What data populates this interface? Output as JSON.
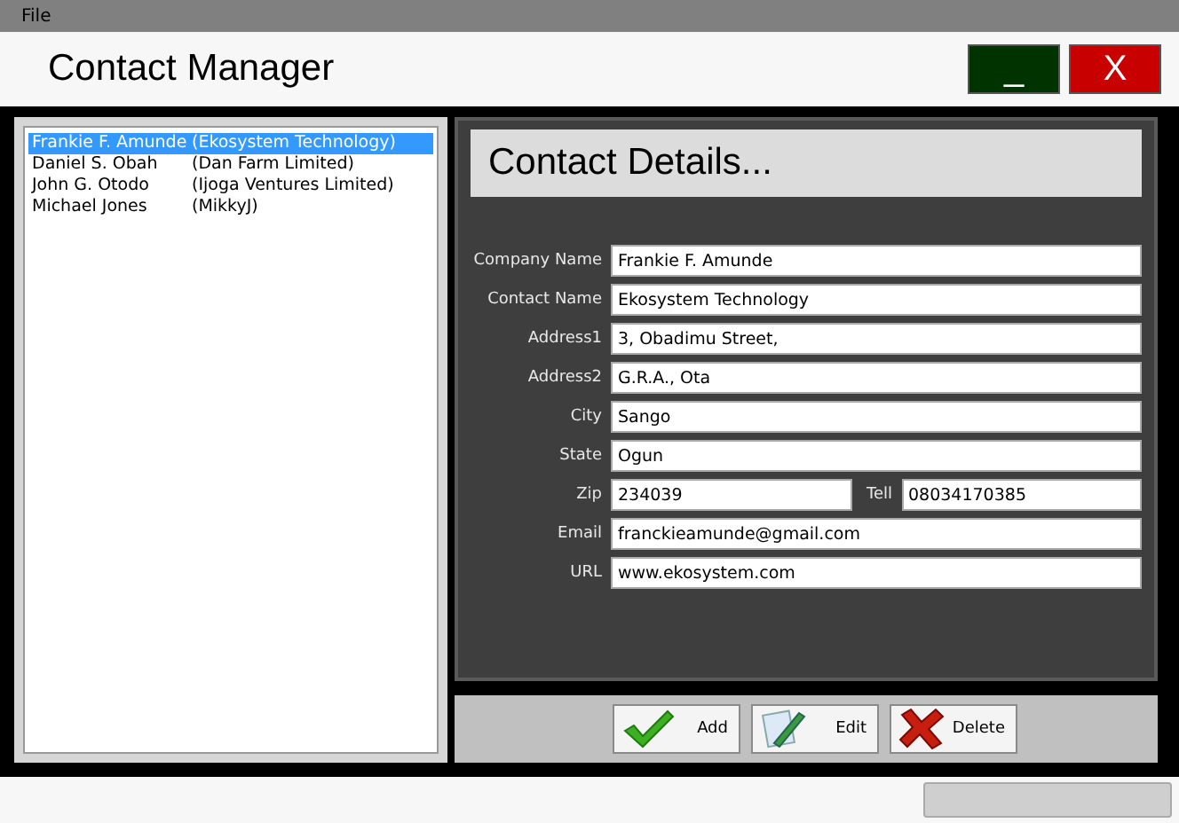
{
  "menu": [
    "File"
  ],
  "window": {
    "title": "Contact Manager",
    "buttons": [
      {
        "kind": "minimize",
        "label": "_"
      },
      {
        "kind": "close",
        "label": "X"
      }
    ]
  },
  "contacts": [
    {
      "name": "Frankie F. Amunde",
      "company": "(Ekosystem Technology)",
      "selected": true
    },
    {
      "name": "Daniel S. Obah",
      "company": "(Dan Farm Limited)",
      "selected": false
    },
    {
      "name": "John G. Otodo",
      "company": "(Ijoga Ventures Limited)",
      "selected": false
    },
    {
      "name": "Michael Jones",
      "company": "(MikkyJ)",
      "selected": false
    }
  ],
  "details": {
    "heading": "Contact Details...",
    "rows": [
      {
        "fields": [
          {
            "label": "Company Name",
            "value": "Frankie F. Amunde"
          }
        ]
      },
      {
        "fields": [
          {
            "label": "Contact Name",
            "value": "Ekosystem Technology"
          }
        ]
      },
      {
        "fields": [
          {
            "label": "Address1",
            "value": "3, Obadimu Street,"
          }
        ]
      },
      {
        "fields": [
          {
            "label": "Address2",
            "value": "G.R.A., Ota"
          }
        ]
      },
      {
        "fields": [
          {
            "label": "City",
            "value": "Sango"
          }
        ]
      },
      {
        "fields": [
          {
            "label": "State",
            "value": "Ogun"
          }
        ]
      },
      {
        "fields": [
          {
            "label": "Zip",
            "value": "234039"
          },
          {
            "label": "Tell",
            "value": "08034170385"
          }
        ]
      },
      {
        "fields": [
          {
            "label": "Email",
            "value": "franckieamunde@gmail.com"
          }
        ]
      },
      {
        "fields": [
          {
            "label": "URL",
            "value": "www.ekosystem.com"
          }
        ]
      }
    ]
  },
  "actions": [
    {
      "kind": "add",
      "label": "Add"
    },
    {
      "kind": "edit",
      "label": "Edit"
    },
    {
      "kind": "delete",
      "label": "Delete"
    }
  ],
  "status_bar": {
    "progress": {
      "level": 0
    }
  }
}
